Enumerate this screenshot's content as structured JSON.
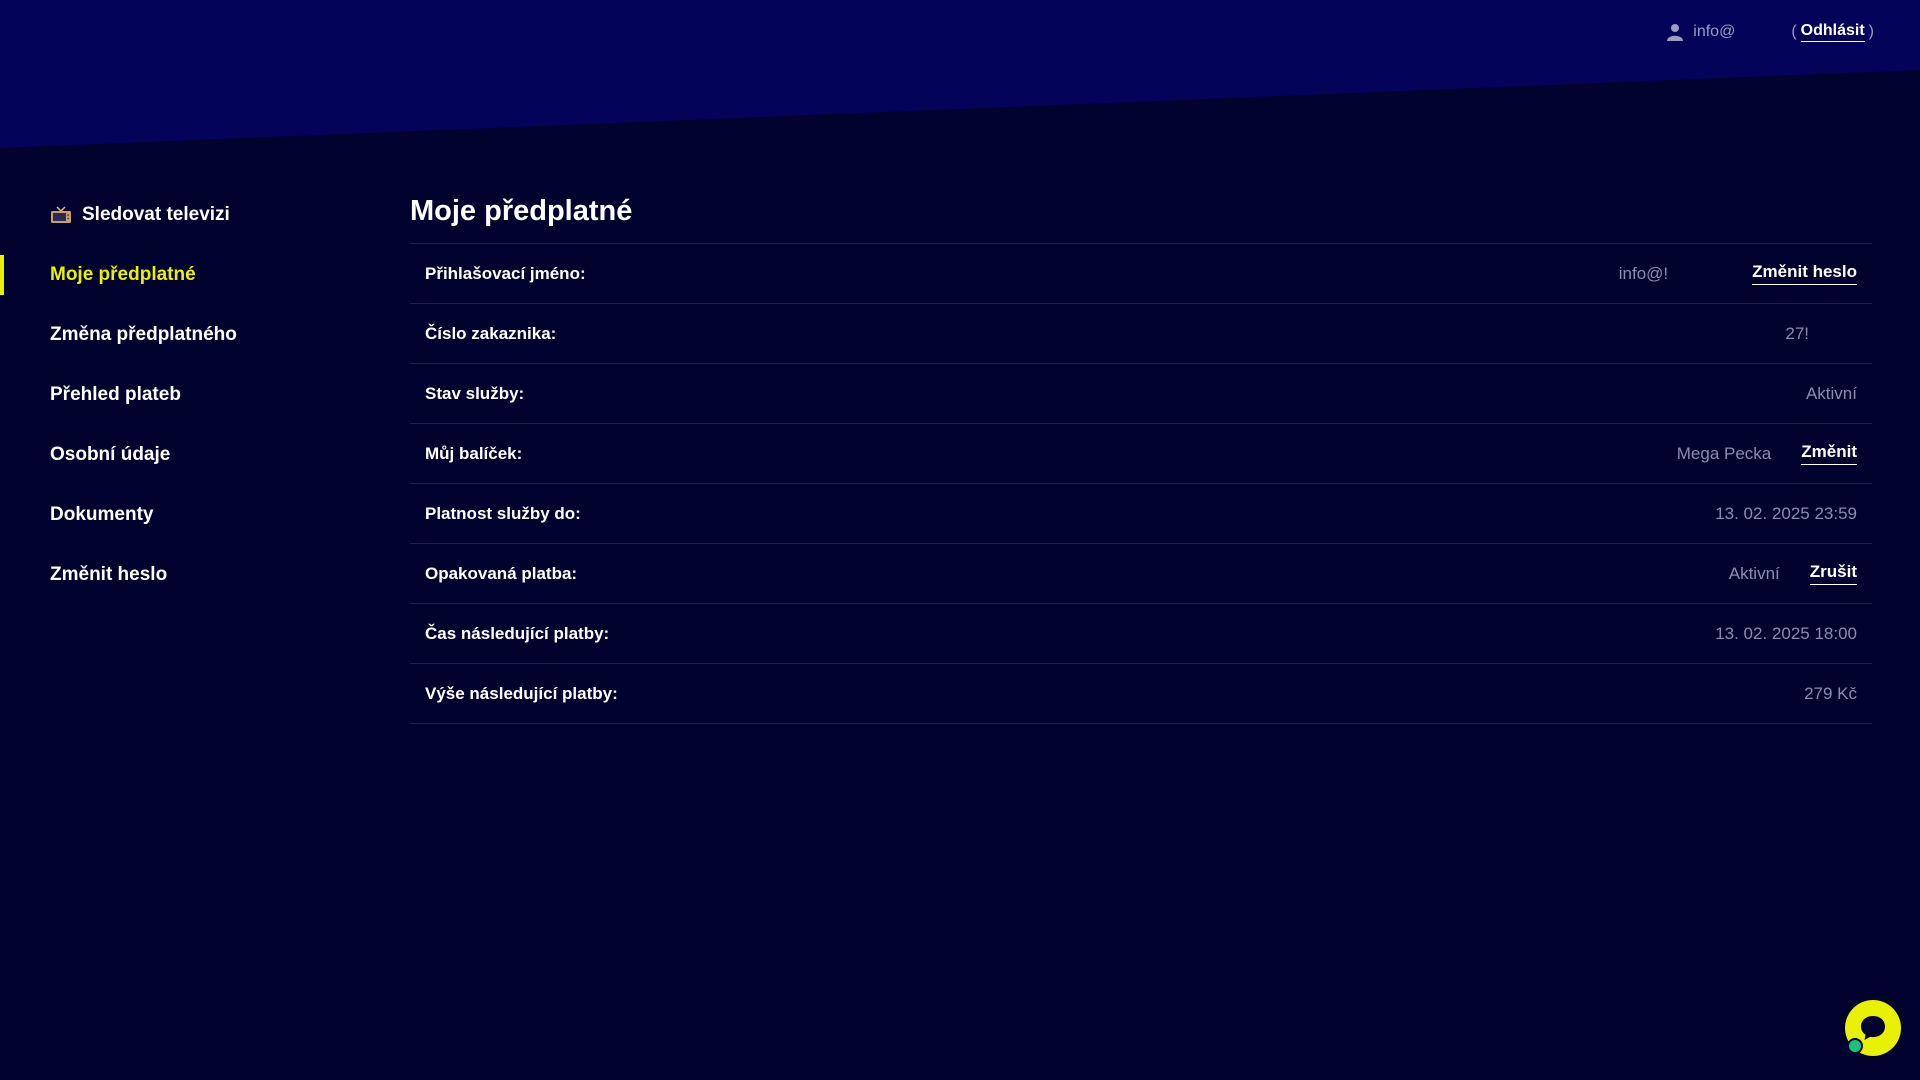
{
  "header": {
    "user_name": "info@",
    "paren_open": "(",
    "logout_label": "Odhlásit",
    "paren_close": ")"
  },
  "sidebar": {
    "items": [
      {
        "label": "Sledovat televizi",
        "icon": "tv-icon"
      },
      {
        "label": "Moje předplatné",
        "active": true
      },
      {
        "label": "Změna předplatného"
      },
      {
        "label": "Přehled plateb"
      },
      {
        "label": "Osobní údaje"
      },
      {
        "label": "Dokumenty"
      },
      {
        "label": "Změnit heslo"
      }
    ]
  },
  "main": {
    "title": "Moje předplatné",
    "rows": [
      {
        "label": "Přihlašovací jméno:",
        "value": "info@!",
        "action": "Změnit heslo"
      },
      {
        "label": "Číslo zakaznika:",
        "value": "27!"
      },
      {
        "label": "Stav služby:",
        "value": "Aktivní"
      },
      {
        "label": "Můj balíček:",
        "value": "Mega Pecka",
        "action": "Změnit"
      },
      {
        "label": "Platnost služby do:",
        "value": "13. 02. 2025 23:59"
      },
      {
        "label": "Opakovaná platba:",
        "value": "Aktivní",
        "action": "Zrušit"
      },
      {
        "label": "Čas následující platby:",
        "value": "13. 02. 2025 18:00"
      },
      {
        "label": "Výše následující platby:",
        "value": "279 Kč"
      }
    ]
  },
  "colors": {
    "background": "#02022f",
    "header_band": "#03035a",
    "accent": "#e8f100",
    "muted_text": "#8a8cb0",
    "chat_status": "#19c37d"
  }
}
